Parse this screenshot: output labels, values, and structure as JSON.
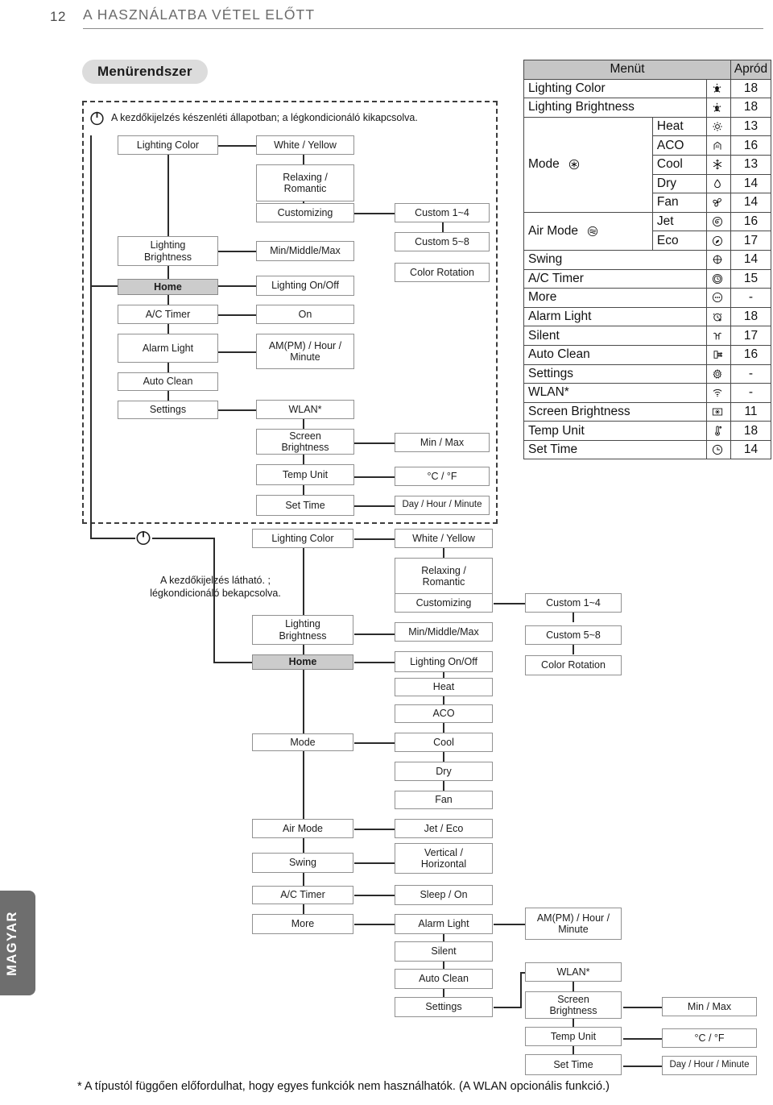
{
  "header": {
    "page_number": "12",
    "title": "A HASZNÁLATBA VÉTEL ELŐTT"
  },
  "section": {
    "pill_label": "Menürendszer"
  },
  "footer": {
    "note": "* A típustól függően előfordulhat, hogy egyes funkciók nem használhatók. (A WLAN opcionális funkció.)"
  },
  "language_tab": {
    "label": "MAGYAR"
  },
  "diagram_standby": {
    "caption": "A kezdőkijelzés készenléti állapotban; a légkondicionáló kikapcsolva.",
    "power_icon": "power-icon",
    "col1": [
      {
        "label": "Lighting Color"
      },
      {
        "label": "Lighting\nBrightness"
      },
      {
        "label": "Home",
        "highlight": true
      },
      {
        "label": "A/C Timer"
      },
      {
        "label": "Alarm Light"
      },
      {
        "label": "Auto Clean"
      },
      {
        "label": "Settings"
      }
    ],
    "col2": [
      {
        "label": "White / Yellow"
      },
      {
        "label": "Relaxing /\nRomantic"
      },
      {
        "label": "Customizing"
      },
      {
        "label": "Min/Middle/Max"
      },
      {
        "label": "Lighting On/Off"
      },
      {
        "label": "On"
      },
      {
        "label": "AM(PM) / Hour /\nMinute"
      },
      {
        "label": "WLAN*"
      },
      {
        "label": "Screen\nBrightness"
      },
      {
        "label": "Temp Unit"
      },
      {
        "label": "Set Time"
      }
    ],
    "col3": [
      {
        "label": "Custom 1~4"
      },
      {
        "label": "Custom 5~8"
      },
      {
        "label": "Color Rotation"
      },
      {
        "label": "Min / Max"
      },
      {
        "label": "°C / °F"
      },
      {
        "label": "Day / Hour / Minute"
      }
    ]
  },
  "diagram_on": {
    "caption_line1": "A kezdőkijelzés látható. ;",
    "caption_line2": "légkondicionáló bekapcsolva.",
    "power_icon": "power-icon",
    "col1": [
      {
        "label": "Lighting Color"
      },
      {
        "label": "Lighting\nBrightness"
      },
      {
        "label": "Home",
        "highlight": true
      },
      {
        "label": "Mode"
      },
      {
        "label": "Air Mode"
      },
      {
        "label": "Swing"
      },
      {
        "label": "A/C Timer"
      },
      {
        "label": "More"
      }
    ],
    "col2": [
      {
        "label": "White / Yellow"
      },
      {
        "label": "Relaxing /\nRomantic"
      },
      {
        "label": "Customizing"
      },
      {
        "label": "Min/Middle/Max"
      },
      {
        "label": "Lighting On/Off"
      },
      {
        "label": "Heat"
      },
      {
        "label": "ACO"
      },
      {
        "label": "Cool"
      },
      {
        "label": "Dry"
      },
      {
        "label": "Fan"
      },
      {
        "label": "Jet / Eco"
      },
      {
        "label": "Vertical /\nHorizontal"
      },
      {
        "label": "Sleep / On"
      },
      {
        "label": "Alarm Light"
      },
      {
        "label": "Silent"
      },
      {
        "label": "Auto Clean"
      },
      {
        "label": "Settings"
      }
    ],
    "col3": [
      {
        "label": "Custom 1~4"
      },
      {
        "label": "Custom 5~8"
      },
      {
        "label": "Color Rotation"
      },
      {
        "label": "AM(PM) / Hour /\nMinute"
      },
      {
        "label": "WLAN*"
      },
      {
        "label": "Screen\nBrightness"
      },
      {
        "label": "Temp Unit"
      },
      {
        "label": "Set Time"
      }
    ],
    "col4": [
      {
        "label": "Min / Max"
      },
      {
        "label": "°C / °F"
      },
      {
        "label": "Day / Hour / Minute"
      }
    ]
  },
  "menu_table": {
    "headers": {
      "menu": "Menüt",
      "page": "Apród"
    },
    "rows": [
      {
        "label": "Lighting Color",
        "icon": "lighting-color-icon",
        "page": "18"
      },
      {
        "label": "Lighting Brightness",
        "icon": "lighting-brightness-icon",
        "page": "18"
      },
      {
        "label": "Heat",
        "group": "Mode",
        "group_icon": "mode-icon",
        "icon": "heat-icon",
        "page": "13"
      },
      {
        "label": "ACO",
        "group": "Mode",
        "icon": "aco-icon",
        "page": "16"
      },
      {
        "label": "Cool",
        "group": "Mode",
        "icon": "cool-icon",
        "page": "13"
      },
      {
        "label": "Dry",
        "group": "Mode",
        "icon": "dry-icon",
        "page": "14"
      },
      {
        "label": "Fan",
        "group": "Mode",
        "icon": "fan-icon",
        "page": "14"
      },
      {
        "label": "Jet",
        "group": "Air Mode",
        "group_icon": "air-mode-icon",
        "icon": "jet-icon",
        "page": "16"
      },
      {
        "label": "Eco",
        "group": "Air Mode",
        "icon": "eco-icon",
        "page": "17"
      },
      {
        "label": "Swing",
        "icon": "swing-icon",
        "page": "14"
      },
      {
        "label": "A/C Timer",
        "icon": "ac-timer-icon",
        "page": "15"
      },
      {
        "label": "More",
        "icon": "more-icon",
        "page": "-"
      },
      {
        "label": "Alarm Light",
        "icon": "alarm-light-icon",
        "page": "18"
      },
      {
        "label": "Silent",
        "icon": "silent-icon",
        "page": "17"
      },
      {
        "label": "Auto Clean",
        "icon": "auto-clean-icon",
        "page": "16"
      },
      {
        "label": "Settings",
        "icon": "settings-gear-icon",
        "page": "-"
      },
      {
        "label": "WLAN*",
        "icon": "wifi-icon",
        "page": "-"
      },
      {
        "label": "Screen Brightness",
        "icon": "screen-brightness-icon",
        "page": "11"
      },
      {
        "label": "Temp Unit",
        "icon": "thermometer-icon",
        "page": "18"
      },
      {
        "label": "Set Time",
        "icon": "clock-icon",
        "page": "14"
      }
    ],
    "group_labels": {
      "mode": "Mode",
      "air_mode": "Air Mode"
    }
  },
  "colors": {
    "pill_bg": "#dcdcdc",
    "home_bg": "#cccccc",
    "table_header_bg": "#c6c6c6",
    "lang_tab_bg": "#6e6e6e",
    "line": "#2b2b2b"
  }
}
